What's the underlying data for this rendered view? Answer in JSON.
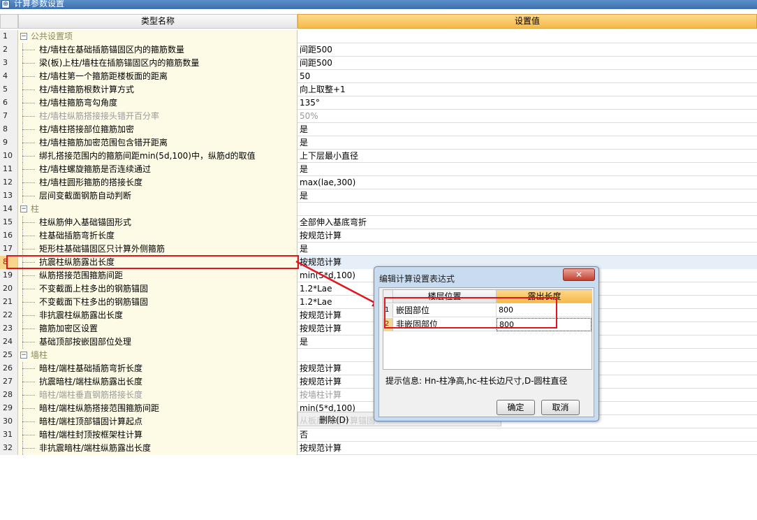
{
  "window": {
    "title": "计算参数设置",
    "icon": "app-icon",
    "icon_glyph": "⊕"
  },
  "grid": {
    "headers": {
      "name": "类型名称",
      "value": "设置值"
    },
    "rows": [
      {
        "idx": "1",
        "name": "公共设置项",
        "value": "",
        "type": "group",
        "toggle": "−"
      },
      {
        "idx": "2",
        "name": "柱/墙柱在基础插筋锚固区内的箍筋数量",
        "value": "间距500"
      },
      {
        "idx": "3",
        "name": "梁(板)上柱/墙柱在插筋锚固区内的箍筋数量",
        "value": "间距500"
      },
      {
        "idx": "4",
        "name": "柱/墙柱第一个箍筋距楼板面的距离",
        "value": "50"
      },
      {
        "idx": "5",
        "name": "柱/墙柱箍筋根数计算方式",
        "value": "向上取整+1"
      },
      {
        "idx": "6",
        "name": "柱/墙柱箍筋弯勾角度",
        "value": "135°"
      },
      {
        "idx": "7",
        "name": "柱/墙柱纵筋搭接接头错开百分率",
        "value": "50%",
        "type": "disabled"
      },
      {
        "idx": "8",
        "name": "柱/墙柱搭接部位箍筋加密",
        "value": "是"
      },
      {
        "idx": "9",
        "name": "柱/墙柱箍筋加密范围包含错开距离",
        "value": "是"
      },
      {
        "idx": "10",
        "name": "绑扎搭接范围内的箍筋间距min(5d,100)中，纵筋d的取值",
        "value": "上下层最小直径"
      },
      {
        "idx": "11",
        "name": "柱/墙柱螺旋箍筋是否连续通过",
        "value": "是"
      },
      {
        "idx": "12",
        "name": "柱/墙柱圆形箍筋的搭接长度",
        "value": "max(lae,300)"
      },
      {
        "idx": "13",
        "name": "层间变截面钢筋自动判断",
        "value": "是"
      },
      {
        "idx": "14",
        "name": "柱",
        "value": "",
        "type": "group",
        "toggle": "−"
      },
      {
        "idx": "15",
        "name": "柱纵筋伸入基础锚固形式",
        "value": "全部伸入基底弯折"
      },
      {
        "idx": "16",
        "name": "柱基础插筋弯折长度",
        "value": "按规范计算"
      },
      {
        "idx": "17",
        "name": "矩形柱基础锚固区只计算外侧箍筋",
        "value": "是"
      },
      {
        "idx": "8",
        "name": "抗震柱纵筋露出长度",
        "value": "按规范计算",
        "type": "selected"
      },
      {
        "idx": "19",
        "name": "纵筋搭接范围箍筋间距",
        "value": "min(5*d,100)"
      },
      {
        "idx": "20",
        "name": "不变截面上柱多出的钢筋锚固",
        "value": "1.2*Lae"
      },
      {
        "idx": "21",
        "name": "不变截面下柱多出的钢筋锚固",
        "value": "1.2*Lae"
      },
      {
        "idx": "22",
        "name": "非抗震柱纵筋露出长度",
        "value": "按规范计算"
      },
      {
        "idx": "23",
        "name": "箍筋加密区设置",
        "value": "按规范计算"
      },
      {
        "idx": "24",
        "name": "基础顶部按嵌固部位处理",
        "value": "是"
      },
      {
        "idx": "25",
        "name": "墙柱",
        "value": "",
        "type": "group",
        "toggle": "−"
      },
      {
        "idx": "26",
        "name": "暗柱/端柱基础插筋弯折长度",
        "value": "按规范计算"
      },
      {
        "idx": "27",
        "name": "抗震暗柱/端柱纵筋露出长度",
        "value": "按规范计算"
      },
      {
        "idx": "28",
        "name": "暗柱/端柱垂直钢筋搭接长度",
        "value": "按墙柱计算",
        "type": "disabled"
      },
      {
        "idx": "29",
        "name": "暗柱/端柱纵筋搭接范围箍筋间距",
        "value": "min(5*d,100)"
      },
      {
        "idx": "30",
        "name": "暗柱/端柱顶部锚固计算起点",
        "value": ""
      },
      {
        "idx": "31",
        "name": "暗柱/端柱封顶按框架柱计算",
        "value": "否"
      },
      {
        "idx": "32",
        "name": "非抗震暗柱/端柱纵筋露出长度",
        "value": "按规范计算"
      }
    ]
  },
  "context_menu": {
    "faded_text": "从板底开始计算锚固",
    "delete_label": "删除(D)"
  },
  "dialog": {
    "title": "编辑计算设置表达式",
    "close_glyph": "✕",
    "headers": {
      "c1": "楼层位置",
      "c2": "露出长度"
    },
    "rows": [
      {
        "idx": "1",
        "c1": "嵌固部位",
        "c2": "800"
      },
      {
        "idx": "2",
        "c1": "非嵌固部位",
        "c2": "800"
      }
    ],
    "hint": "提示信息: Hn-柱净高,hc-柱长边尺寸,D-圆柱直径",
    "ok_label": "确定",
    "cancel_label": "取消"
  },
  "colors": {
    "highlight": "#e0161c",
    "header_accent": "#f5b94a",
    "name_column_bg": "#fdfbe6"
  }
}
